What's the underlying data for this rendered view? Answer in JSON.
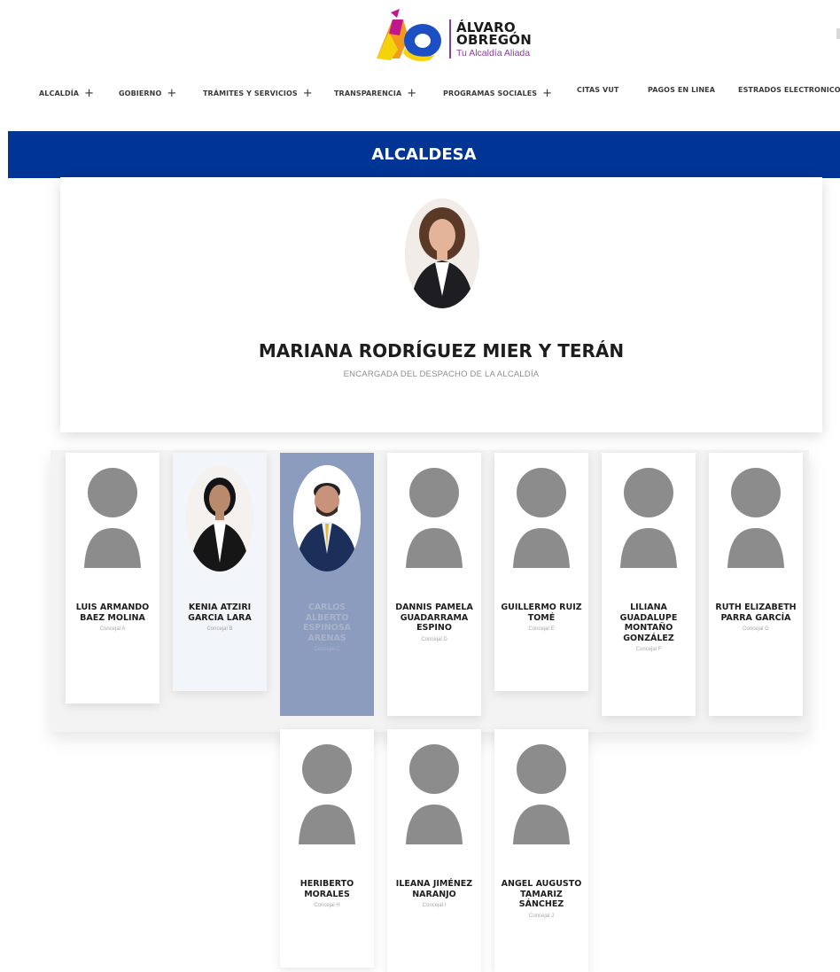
{
  "brand": {
    "name_line1": "ÁLVARO",
    "name_line2": "OBREGÓN",
    "tagline": "Tu Alcaldía Aliada",
    "colors": {
      "blue": "#1d4fc4",
      "yellow": "#f6d20a",
      "magenta": "#c0198e",
      "orange": "#f39a1c",
      "purple": "#8a3d9e"
    }
  },
  "nav": [
    {
      "label": "ALCALDÍA",
      "plus": "+"
    },
    {
      "label": "GOBIERNO",
      "plus": "+"
    },
    {
      "label": "TRÁMITES Y SERVICIOS",
      "plus": "+"
    },
    {
      "label": "TRANSPARENCIA",
      "plus": "+"
    },
    {
      "label": "PROGRAMAS SOCIALES",
      "plus": "+"
    },
    {
      "label": "CITAS VUT",
      "plus": ""
    },
    {
      "label": "PAGOS EN LINEA",
      "plus": ""
    },
    {
      "label": "ESTRADOS ELECTRONICOS",
      "plus": ""
    }
  ],
  "banner": {
    "title": "ALCALDESA",
    "color": "#003595"
  },
  "featured": {
    "name": "MARIANA RODRÍGUEZ MIER Y TERÁN",
    "role": "ENCARGADA DEL DESPACHO DE LA ALCALDÍA",
    "photo_icon": "woman-portrait-photo"
  },
  "council": [
    {
      "name": "LUIS ARMANDO BAEZ MOLINA",
      "role": "Concejal A",
      "photo": "placeholder-avatar-icon"
    },
    {
      "name": "KENIA ATZIRI GARCIA LARA",
      "role": "Concejal B",
      "photo": "woman-portrait-photo"
    },
    {
      "name": "CARLOS ALBERTO ESPINOSA ARENAS",
      "role": "Concejal C",
      "photo": "man-portrait-photo"
    },
    {
      "name": "DANNIS PAMELA GUADARRAMA ESPINO",
      "role": "Concejal D",
      "photo": "placeholder-avatar-icon"
    },
    {
      "name": "GUILLERMO RUIZ TOMÉ",
      "role": "Concejal E",
      "photo": "placeholder-avatar-icon"
    },
    {
      "name": "LILIANA GUADALUPE MONTAÑO GONZÁLEZ",
      "role": "Concejal F",
      "photo": "placeholder-avatar-icon"
    },
    {
      "name": "RUTH ELIZABETH PARRA GARCÍA",
      "role": "Concejal G",
      "photo": "placeholder-avatar-icon"
    },
    {
      "name": "HERIBERTO MORALES",
      "role": "Concejal H",
      "photo": "placeholder-avatar-icon"
    },
    {
      "name": "ILEANA JIMÉNEZ NARANJO",
      "role": "Concejal I",
      "photo": "placeholder-avatar-icon"
    },
    {
      "name": "ANGEL AUGUSTO TAMARIZ SÁNCHEZ",
      "role": "Concejal J",
      "photo": "placeholder-avatar-icon"
    }
  ]
}
